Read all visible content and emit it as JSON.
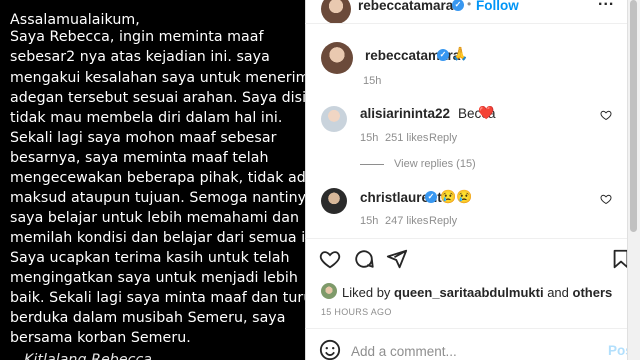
{
  "statement": {
    "lines": [
      "Assalamualaikum,",
      "Saya Rebecca, ingin meminta maaf",
      "sebesar2 nya atas kejadian ini. saya",
      "mengakui kesalahan saya untuk menerima",
      "adegan tersebut sesuai arahan. Saya disini",
      "tidak mau membela diri dalam hal ini.",
      "Sekali lagi saya mohon maaf sebesar",
      "besarnya, saya meminta maaf telah",
      "mengecewakan beberapa pihak, tidak ada",
      "maksud ataupun tujuan. Semoga nantinya",
      "saya belajar untuk lebih memahami dan",
      "memilah kondisi dan belajar dari semua ini.",
      "Saya ucapkan terima kasih untuk telah",
      "mengingatkan saya untuk menjadi lebih",
      "baik. Sekali lagi saya minta maaf dan turut",
      "berduka dalam musibah Semeru, saya",
      "bersama korban Semeru."
    ],
    "signature_partial": "Kitlalang Rebecca"
  },
  "header": {
    "username": "rebeccatamara",
    "separator": "•",
    "follow_label": "Follow",
    "more_label": "..."
  },
  "caption": {
    "username": "rebeccatamara",
    "emoji": "🙏",
    "time": "15h"
  },
  "comments": [
    {
      "username": "alisiarininta22",
      "text": "Becca",
      "emoji": "❤️",
      "time": "15h",
      "likes": "251 likes",
      "reply_label": "Reply",
      "view_replies": "View replies (15)"
    },
    {
      "username": "christlaurent",
      "text": "",
      "emoji": "😢😢",
      "time": "15h",
      "likes": "247 likes",
      "reply_label": "Reply"
    }
  ],
  "likes_summary": {
    "prefix": "Liked by ",
    "user": "queen_saritaabdulmukti",
    "middle": " and ",
    "others": "others"
  },
  "post_time": "15 HOURS AGO",
  "composer": {
    "placeholder": "Add a comment...",
    "post_label": "Post"
  },
  "colors": {
    "accent": "#0095f6",
    "verified": "#3897f0",
    "heart": "#ed4956"
  }
}
